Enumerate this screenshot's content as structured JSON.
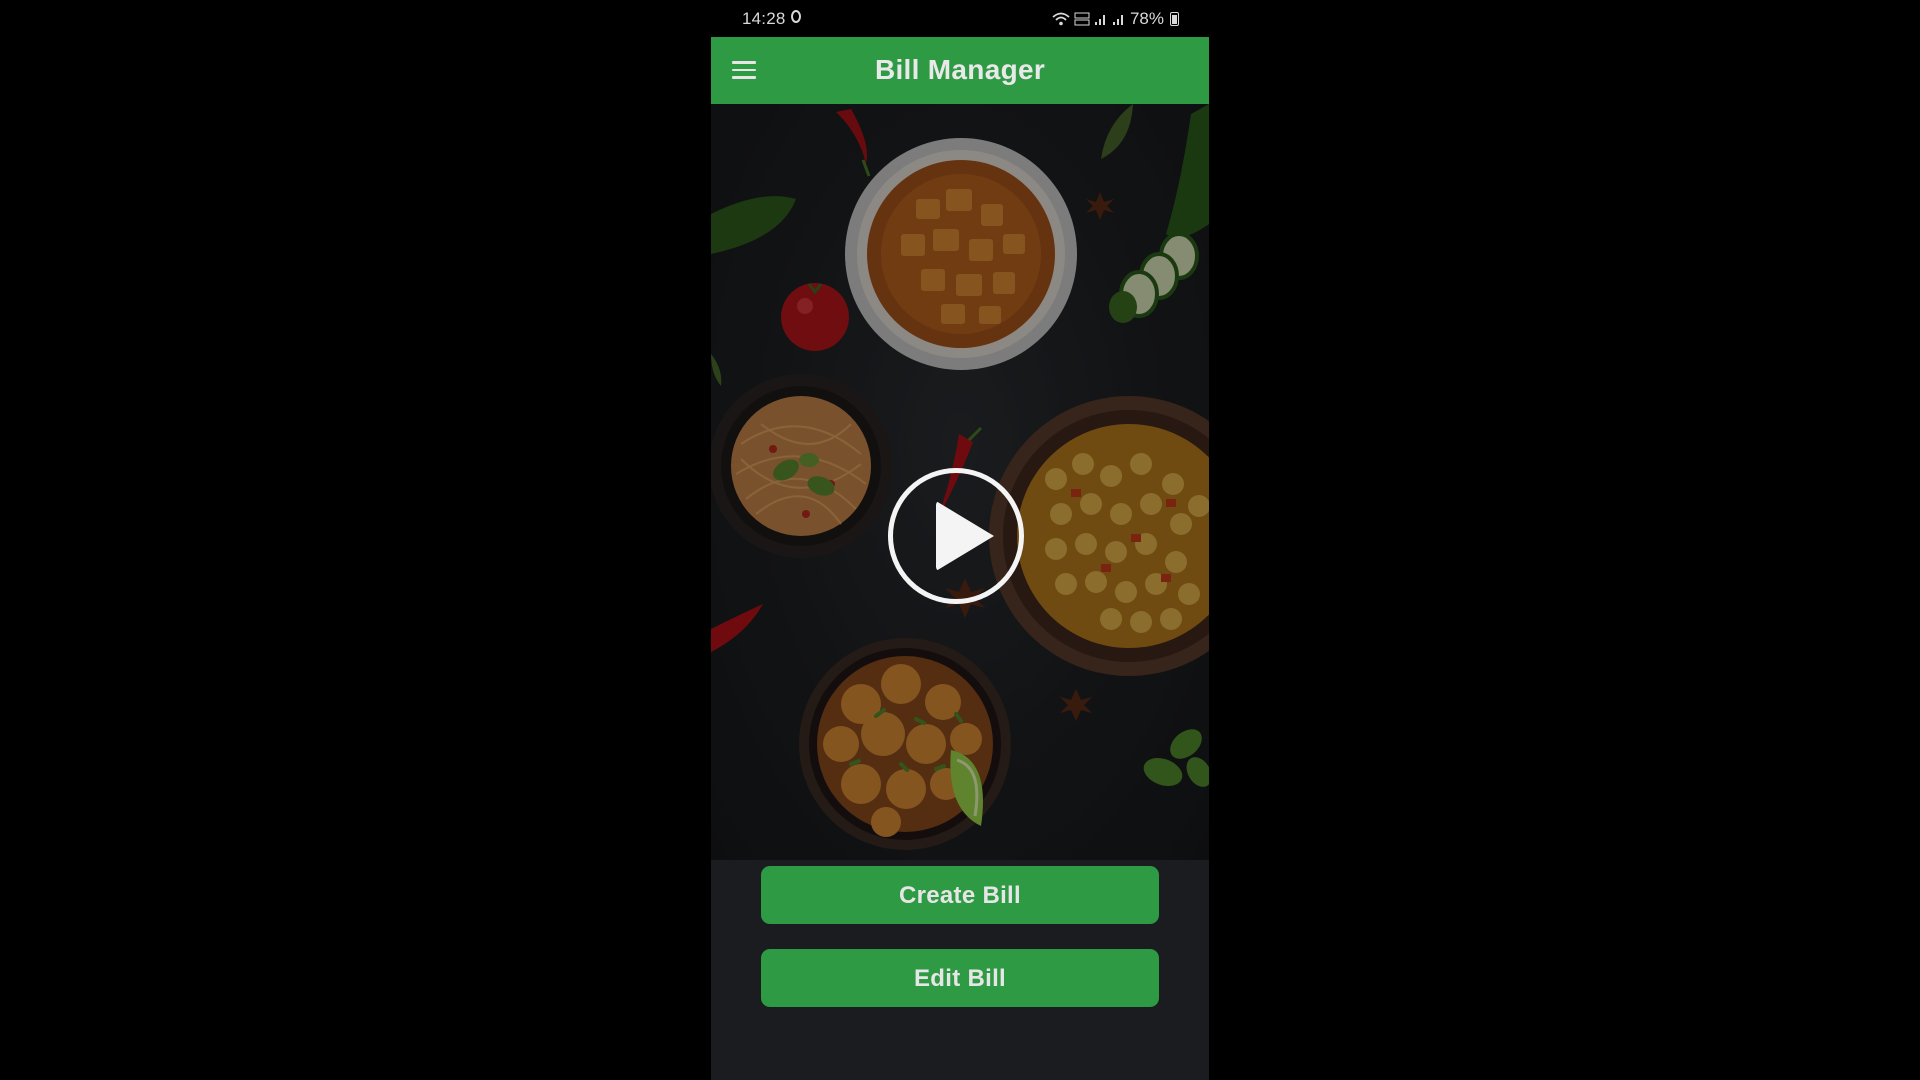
{
  "status_bar": {
    "time": "14:28",
    "battery": "78%",
    "volte_label": "Vo)) LTE1"
  },
  "app_bar": {
    "title": "Bill Manager",
    "menu_icon": "hamburger-menu-icon"
  },
  "hero": {
    "play_icon": "play-circle-icon"
  },
  "actions": {
    "create_bill": "Create Bill",
    "edit_bill": "Edit Bill"
  },
  "colors": {
    "primary_green": "#2f9a44",
    "background": "#1a1c1f",
    "text_light": "#e6e6e6"
  }
}
